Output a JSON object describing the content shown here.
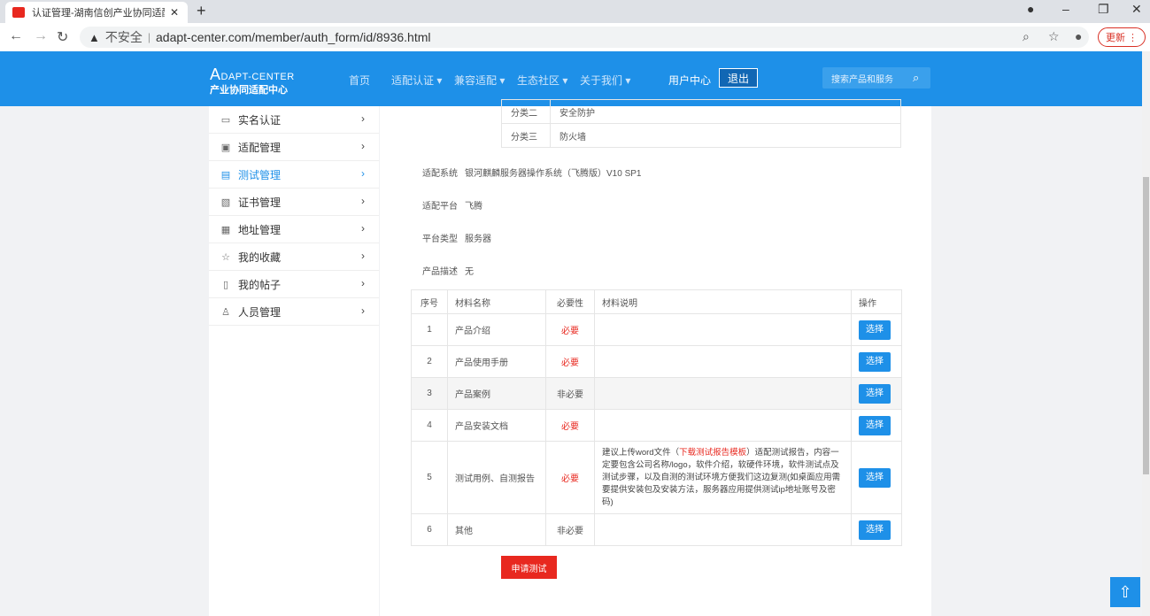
{
  "browser": {
    "tab_title": "认证管理-湖南信创产业协同适配",
    "tab_close": "✕",
    "new_tab": "+",
    "insecure_label": "不安全",
    "url": "adapt-center.com/member/auth_form/id/8936.html",
    "update_label": "更新"
  },
  "site": {
    "logo_top_big": "A",
    "logo_top_rest": "DAPT-CENTER",
    "logo_bottom": "产业协同适配中心",
    "nav": [
      "首页",
      "适配认证 ▾",
      "兼容适配 ▾",
      "生态社区 ▾",
      "关于我们 ▾"
    ],
    "user_center": "用户中心",
    "logout": "退出",
    "search_placeholder": "搜索产品和服务"
  },
  "sidebar": {
    "items": [
      {
        "label": "实名认证",
        "icon": "id-card-icon"
      },
      {
        "label": "适配管理",
        "icon": "monitor-icon"
      },
      {
        "label": "测试管理",
        "icon": "document-icon"
      },
      {
        "label": "证书管理",
        "icon": "certificate-icon"
      },
      {
        "label": "地址管理",
        "icon": "address-icon"
      },
      {
        "label": "我的收藏",
        "icon": "star-icon"
      },
      {
        "label": "我的帖子",
        "icon": "post-icon"
      },
      {
        "label": "人员管理",
        "icon": "users-icon"
      }
    ],
    "active_index": 2
  },
  "classification": [
    {
      "key": "分类二",
      "value": "安全防护"
    },
    {
      "key": "分类三",
      "value": "防火墙"
    }
  ],
  "info": [
    {
      "key": "适配系统",
      "value": "银河麒麟服务器操作系统（飞腾版）V10 SP1"
    },
    {
      "key": "适配平台",
      "value": "飞腾"
    },
    {
      "key": "平台类型",
      "value": "服务器"
    },
    {
      "key": "产品描述",
      "value": "无"
    }
  ],
  "materials": {
    "headers": [
      "序号",
      "材料名称",
      "必要性",
      "材料说明",
      "操作"
    ],
    "rows": [
      {
        "no": "1",
        "name": "产品介绍",
        "need": "必要",
        "required": true,
        "desc": "",
        "action": "选择"
      },
      {
        "no": "2",
        "name": "产品使用手册",
        "need": "必要",
        "required": true,
        "desc": "",
        "action": "选择"
      },
      {
        "no": "3",
        "name": "产品案例",
        "need": "非必要",
        "required": false,
        "desc": "",
        "action": "选择"
      },
      {
        "no": "4",
        "name": "产品安装文档",
        "need": "必要",
        "required": true,
        "desc": "",
        "action": "选择"
      },
      {
        "no": "5",
        "name": "测试用例、自测报告",
        "need": "必要",
        "required": true,
        "desc_pre": "建议上传word文件（",
        "desc_link": "下载测试报告模板",
        "desc_post": "）适配测试报告，内容一定要包含公司名称/logo，软件介绍，软硬件环境，软件测试点及测试步骤，以及自测的测试环境方便我们这边复测(如桌面应用需要提供安装包及安装方法，服务器应用提供测试ip地址账号及密码)",
        "action": "选择"
      },
      {
        "no": "6",
        "name": "其他",
        "need": "非必要",
        "required": false,
        "desc": "",
        "action": "选择"
      }
    ]
  },
  "apply_button": "申请测试",
  "colors": {
    "brand_blue": "#1e90e8",
    "required_red": "#e8281f"
  }
}
